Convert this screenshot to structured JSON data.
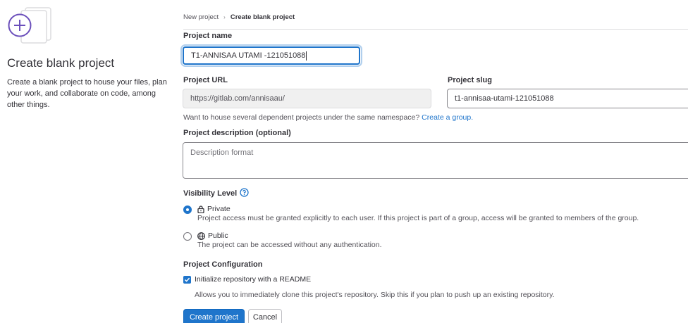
{
  "left": {
    "title": "Create blank project",
    "description": "Create a blank project to house your files, plan your work, and collaborate on code, among other things."
  },
  "breadcrumb": {
    "parent": "New project",
    "current": "Create blank project"
  },
  "form": {
    "project_name_label": "Project name",
    "project_name_value": "T1-ANNISAA UTAMI -121051088",
    "project_url_label": "Project URL",
    "project_url_value": "https://gitlab.com/annisaau/",
    "project_slug_label": "Project slug",
    "project_slug_value": "t1-annisaa-utami-121051088",
    "namespace_hint": "Want to house several dependent projects under the same namespace?",
    "namespace_link": "Create a group.",
    "description_label": "Project description (optional)",
    "description_placeholder": "Description format"
  },
  "visibility": {
    "label": "Visibility Level",
    "options": [
      {
        "title": "Private",
        "description": "Project access must be granted explicitly to each user. If this project is part of a group, access will be granted to members of the group.",
        "selected": true,
        "icon": "lock-icon"
      },
      {
        "title": "Public",
        "description": "The project can be accessed without any authentication.",
        "selected": false,
        "icon": "globe-icon"
      }
    ]
  },
  "configuration": {
    "label": "Project Configuration",
    "readme_label": "Initialize repository with a README",
    "readme_checked": true,
    "readme_help": "Allows you to immediately clone this project's repository. Skip this if you plan to push up an existing repository."
  },
  "actions": {
    "create_label": "Create project",
    "cancel_label": "Cancel"
  },
  "colors": {
    "accent": "#1f75cb",
    "illustration": "#6b4fbb"
  }
}
